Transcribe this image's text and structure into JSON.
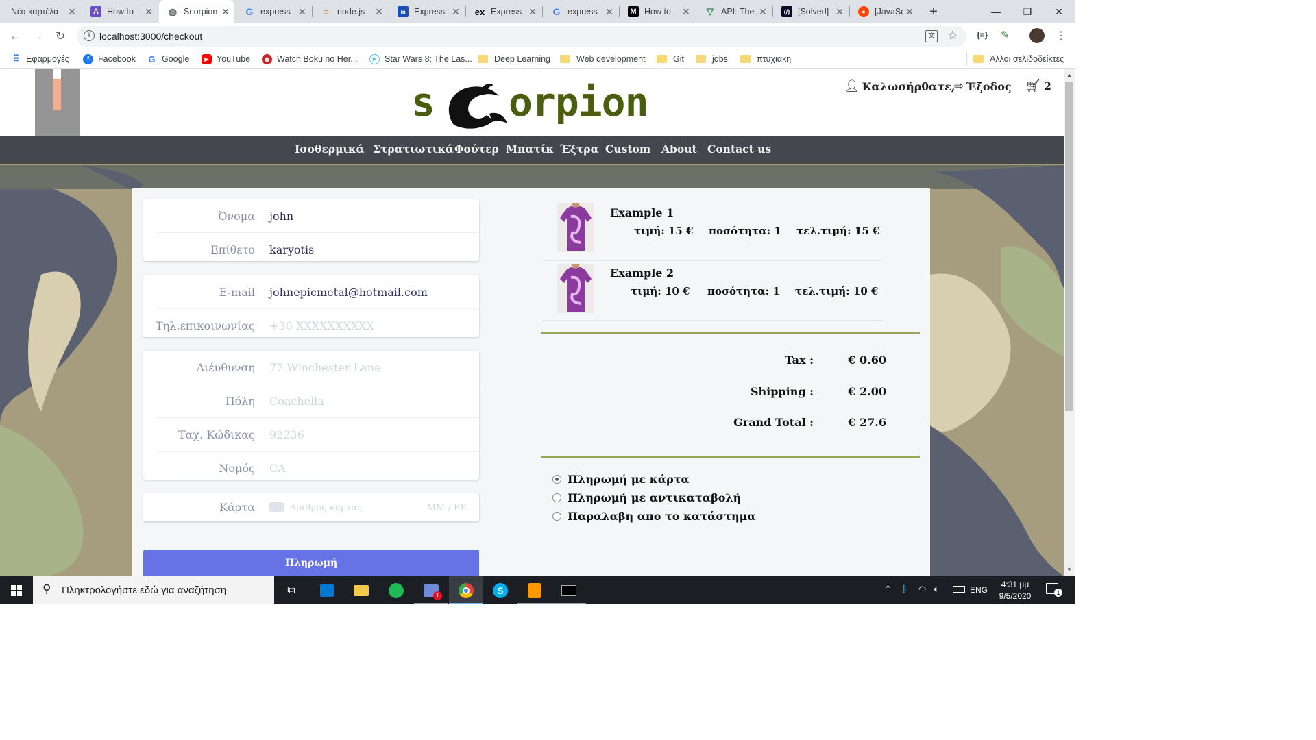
{
  "browser": {
    "tabs": [
      {
        "title": "Νέα καρτέλα",
        "icon": "new-tab-icon"
      },
      {
        "title": "How to",
        "icon": "tab-favicon-purple"
      },
      {
        "title": "Scorpion",
        "icon": "globe-icon",
        "active": true
      },
      {
        "title": "express",
        "icon": "google-icon"
      },
      {
        "title": "node.js",
        "icon": "stackoverflow-icon"
      },
      {
        "title": "Express",
        "icon": "tab-favicon-blue"
      },
      {
        "title": "Express",
        "icon": "express-icon"
      },
      {
        "title": "express",
        "icon": "google-icon"
      },
      {
        "title": "How to",
        "icon": "medium-icon"
      },
      {
        "title": "API: The",
        "icon": "vue-icon"
      },
      {
        "title": "[Solved]",
        "icon": "freecodecamp-icon"
      },
      {
        "title": "[JavaScr",
        "icon": "reddit-icon"
      }
    ],
    "new_tab": "+",
    "url": "localhost:3000/checkout",
    "bookmarks": [
      {
        "label": "Εφαρμογές",
        "icon": "apps-icon"
      },
      {
        "label": "Facebook",
        "icon": "facebook-icon"
      },
      {
        "label": "Google",
        "icon": "google-icon"
      },
      {
        "label": "YouTube",
        "icon": "youtube-icon"
      },
      {
        "label": "Watch Boku no Her...",
        "icon": "site-icon"
      },
      {
        "label": "Star Wars 8: The Las...",
        "icon": "play-icon"
      },
      {
        "label": "Deep Learning",
        "icon": "folder-icon"
      },
      {
        "label": "Web development",
        "icon": "folder-icon"
      },
      {
        "label": "Git",
        "icon": "folder-icon"
      },
      {
        "label": "jobs",
        "icon": "folder-icon"
      },
      {
        "label": "πτυχιακη",
        "icon": "folder-icon"
      }
    ],
    "other_bookmarks": "Άλλοι σελιδοδείκτες"
  },
  "site": {
    "logo_text": "s orpion",
    "user": {
      "welcome": "Καλωσήρθατε,",
      "logout": "Έξοδος",
      "cart_count": "2"
    },
    "nav": [
      "Ισοθερμικά",
      "Στρατιωτικά",
      "Φούτερ",
      "Μπατίκ",
      "Έξτρα",
      "Custom",
      "About",
      "Contact us"
    ]
  },
  "form": {
    "name": {
      "label": "Όνομα",
      "value": "john"
    },
    "surname": {
      "label": "Επίθετο",
      "value": "karyotis"
    },
    "email": {
      "label": "E-mail",
      "value": "johnepicmetal@hotmail.com"
    },
    "phone": {
      "label": "Τηλ.επικοινωνίας",
      "placeholder": "+30 XXXXXXXXXX"
    },
    "address": {
      "label": "Διέυθυνση",
      "placeholder": "77 Winchester Lane"
    },
    "city": {
      "label": "Πόλη",
      "placeholder": "Coachella"
    },
    "zip": {
      "label": "Ταχ. Κώδικας",
      "placeholder": "92236"
    },
    "state": {
      "label": "Νομός",
      "placeholder": "CA"
    },
    "card": {
      "label": "Κάρτα",
      "placeholder": "Αριθμός κάρτας",
      "expiry": "MM / ΕΕ"
    },
    "pay_button": "Πληρωμή"
  },
  "order": {
    "items": [
      {
        "name": "Example 1",
        "price": "τιμή: 15 €",
        "qty": "ποσότητα: 1",
        "total": "τελ.τιμή: 15 €"
      },
      {
        "name": "Example 2",
        "price": "τιμή: 10 €",
        "qty": "ποσότητα: 1",
        "total": "τελ.τιμή: 10 €"
      }
    ],
    "tax": {
      "label": "Tax :",
      "value": "€ 0.60"
    },
    "shipping": {
      "label": "Shipping :",
      "value": "€ 2.00"
    },
    "grand_total": {
      "label": "Grand Total :",
      "value": "€ 27.6"
    },
    "payment_options": [
      {
        "label": "Πληρωμή με κάρτα",
        "selected": true
      },
      {
        "label": "Πληρωμή με αντικαταβολή",
        "selected": false
      },
      {
        "label": "Παραλαβη απο το κατάστημα",
        "selected": false
      }
    ]
  },
  "taskbar": {
    "search_placeholder": "Πληκτρολογήστε εδώ για αναζήτηση",
    "language": "ENG",
    "time": "4:31 μμ",
    "date": "9/5/2020",
    "notification_count": "1",
    "discord_badge": "1"
  },
  "colors": {
    "navbar": "#44484e",
    "accent_line": "#9aa35a",
    "pay_button": "#6772e5",
    "logo_green": "#4b5e0f"
  }
}
